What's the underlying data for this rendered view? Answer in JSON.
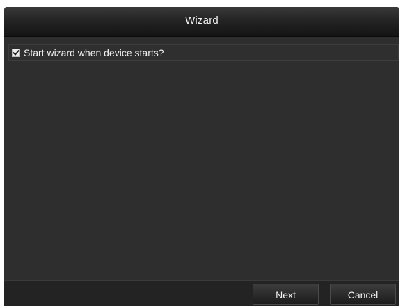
{
  "dialog": {
    "title": "Wizard"
  },
  "option": {
    "label": "Start wizard when device starts?",
    "checked": true,
    "check_icon": "checkmark-icon"
  },
  "buttons": {
    "next_label": "Next",
    "cancel_label": "Cancel"
  },
  "colors": {
    "background": "#2e2e2e",
    "titlebar": "#1a1a1a",
    "text": "#f0f0f0"
  }
}
